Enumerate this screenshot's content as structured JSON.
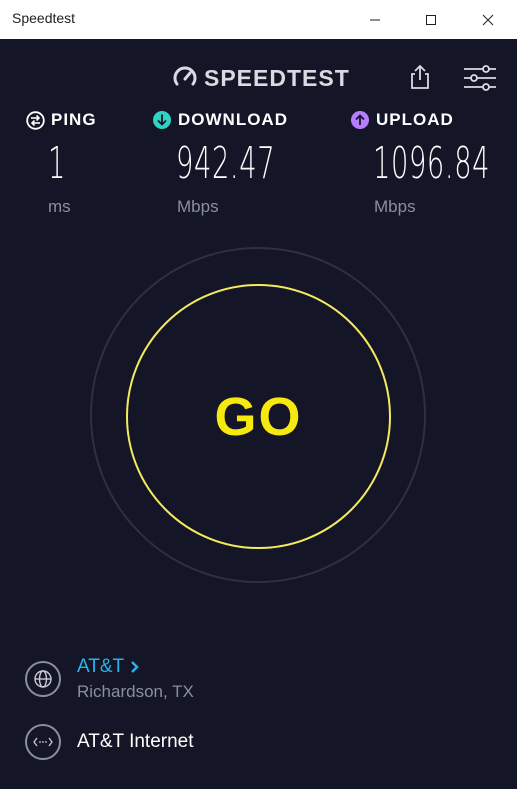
{
  "window": {
    "title": "Speedtest",
    "controls": [
      "minimize",
      "maximize",
      "close"
    ]
  },
  "header": {
    "logo_text": "SPEEDTEST",
    "logo_icon": "gauge-icon",
    "share_icon": "share-icon",
    "settings_icon": "settings-sliders-icon"
  },
  "metrics": {
    "ping": {
      "label": "PING",
      "value": "1",
      "unit": "ms",
      "icon": "ping-icon",
      "icon_color": "#ffffff"
    },
    "download": {
      "label": "DOWNLOAD",
      "value": "942.47",
      "unit": "Mbps",
      "icon": "download-arrow-icon",
      "icon_color": "#2ed3c5"
    },
    "upload": {
      "label": "UPLOAD",
      "value": "1096.84",
      "unit": "Mbps",
      "icon": "upload-arrow-icon",
      "icon_color": "#b77dff"
    }
  },
  "go_button": {
    "label": "GO",
    "ring_color": "#f4ea5e",
    "text_color": "#f5e90f"
  },
  "server": {
    "name": "AT&T",
    "location": "Richardson, TX",
    "icon": "globe-icon",
    "link_color": "#28b4f0"
  },
  "connection": {
    "name": "AT&T Internet",
    "icon": "connection-dots-icon"
  },
  "colors": {
    "background": "#141526",
    "muted_text": "#8a8ea3"
  }
}
